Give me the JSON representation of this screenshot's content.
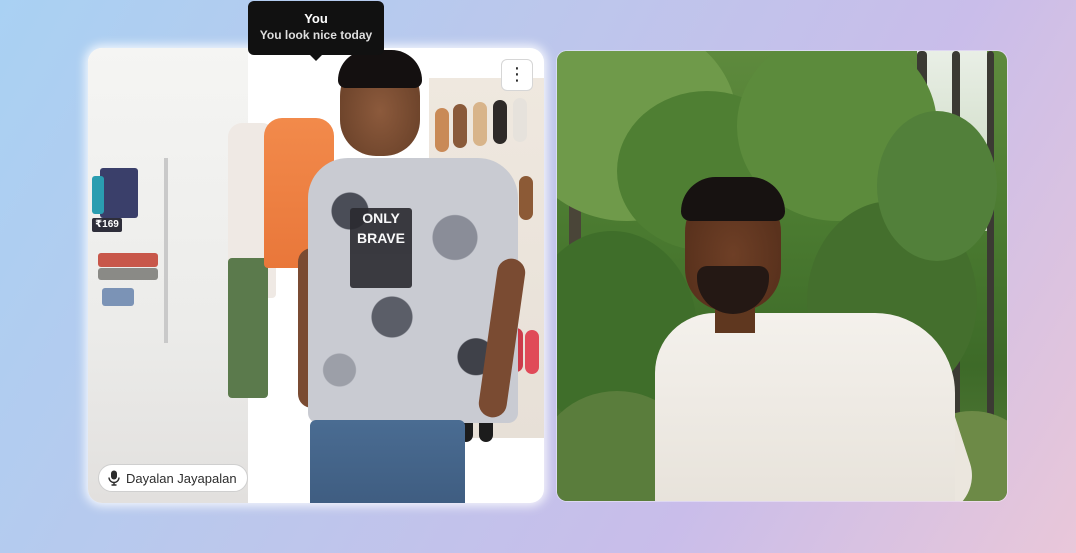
{
  "tiles": [
    {
      "id": "self",
      "participant_name": "Dayalan Jayapalan",
      "mic_icon": "microphone-icon",
      "menu_icon": "more-vertical-icon",
      "menu_glyph": "⋮",
      "tooltip": {
        "title": "You",
        "text": "You look nice today"
      },
      "scene": {
        "price_tag": "₹169",
        "shirt_print": "ONLY BRAVE"
      }
    },
    {
      "id": "remote"
    }
  ],
  "colors": {
    "tooltip_bg": "#111111",
    "chip_bg": "#ffffff"
  }
}
